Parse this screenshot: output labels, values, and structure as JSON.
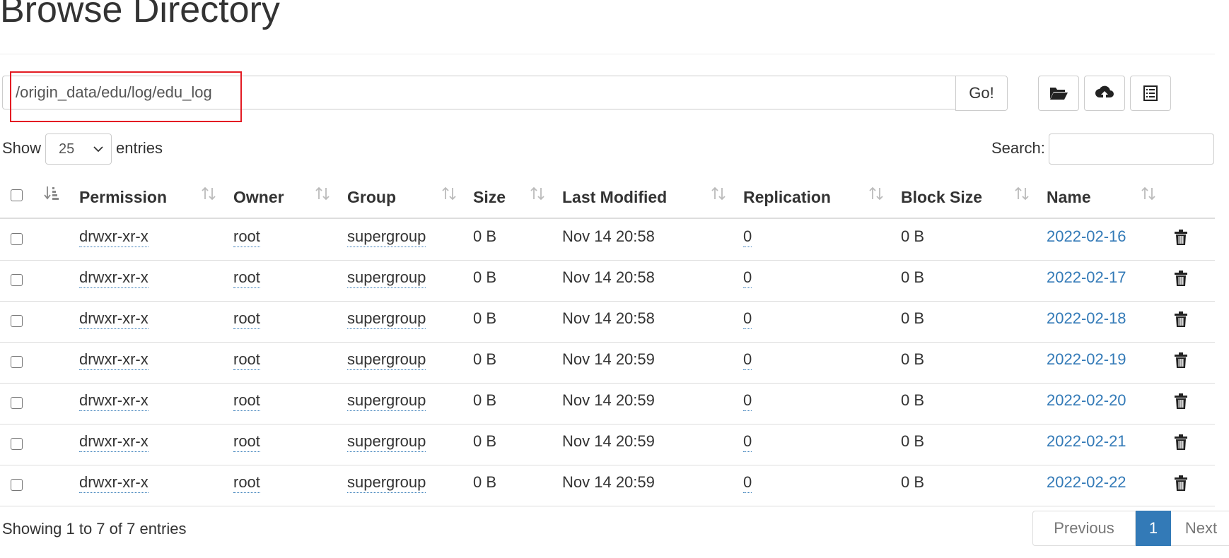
{
  "page": {
    "title": "Browse Directory"
  },
  "path_bar": {
    "value": "/origin_data/edu/log/edu_log",
    "go_label": "Go!"
  },
  "toolbar": {
    "create_dir_icon": "folder-open-icon",
    "upload_icon": "cloud-upload-icon",
    "cut_paste_icon": "list-icon"
  },
  "length_menu": {
    "show_label": "Show",
    "selected": "25",
    "entries_label": "entries"
  },
  "search": {
    "label": "Search:",
    "value": ""
  },
  "table": {
    "headers": {
      "permission": "Permission",
      "owner": "Owner",
      "group": "Group",
      "size": "Size",
      "last_modified": "Last Modified",
      "replication": "Replication",
      "block_size": "Block Size",
      "name": "Name"
    },
    "rows": [
      {
        "permission": "drwxr-xr-x",
        "owner": "root",
        "group": "supergroup",
        "size": "0 B",
        "last_modified": "Nov 14 20:58",
        "replication": "0",
        "block_size": "0 B",
        "name": "2022-02-16"
      },
      {
        "permission": "drwxr-xr-x",
        "owner": "root",
        "group": "supergroup",
        "size": "0 B",
        "last_modified": "Nov 14 20:58",
        "replication": "0",
        "block_size": "0 B",
        "name": "2022-02-17"
      },
      {
        "permission": "drwxr-xr-x",
        "owner": "root",
        "group": "supergroup",
        "size": "0 B",
        "last_modified": "Nov 14 20:58",
        "replication": "0",
        "block_size": "0 B",
        "name": "2022-02-18"
      },
      {
        "permission": "drwxr-xr-x",
        "owner": "root",
        "group": "supergroup",
        "size": "0 B",
        "last_modified": "Nov 14 20:59",
        "replication": "0",
        "block_size": "0 B",
        "name": "2022-02-19"
      },
      {
        "permission": "drwxr-xr-x",
        "owner": "root",
        "group": "supergroup",
        "size": "0 B",
        "last_modified": "Nov 14 20:59",
        "replication": "0",
        "block_size": "0 B",
        "name": "2022-02-20"
      },
      {
        "permission": "drwxr-xr-x",
        "owner": "root",
        "group": "supergroup",
        "size": "0 B",
        "last_modified": "Nov 14 20:59",
        "replication": "0",
        "block_size": "0 B",
        "name": "2022-02-21"
      },
      {
        "permission": "drwxr-xr-x",
        "owner": "root",
        "group": "supergroup",
        "size": "0 B",
        "last_modified": "Nov 14 20:59",
        "replication": "0",
        "block_size": "0 B",
        "name": "2022-02-22"
      }
    ]
  },
  "footer": {
    "info": "Showing 1 to 7 of 7 entries",
    "previous_label": "Previous",
    "current_page": "1",
    "next_label": "Next"
  },
  "colors": {
    "link": "#337ab7",
    "highlight_border": "#e31b23",
    "active_page": "#337ab7"
  }
}
